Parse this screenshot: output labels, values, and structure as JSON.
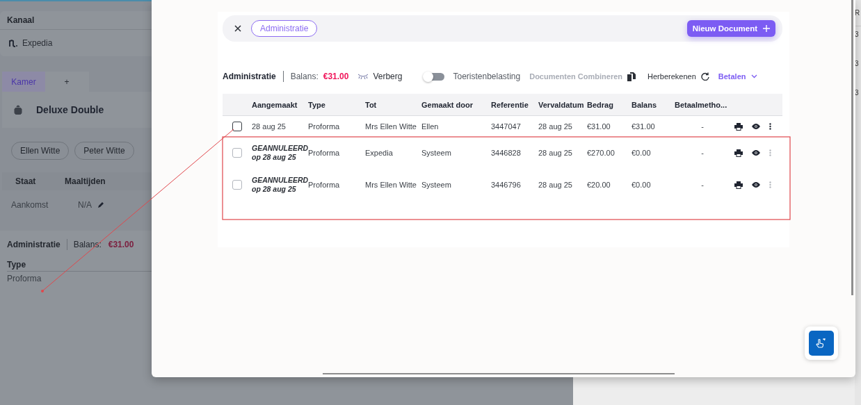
{
  "background": {
    "channel_label": "Kanaal",
    "channel": "Expedia",
    "tabs": [
      {
        "label": "Kamer",
        "selected": true
      },
      {
        "label": "+",
        "selected": false
      }
    ],
    "room": "Deluxe Double",
    "guests": [
      "Ellen Witte",
      "Peter Witte"
    ],
    "columns": [
      "Staat",
      "Maaltijden"
    ],
    "row": [
      "Aankomst",
      "N/A"
    ],
    "admin": {
      "title": "Administratie",
      "balance_label": "Balans:",
      "balance": "€31.00",
      "type_label": "Type",
      "type_value": "Proforma"
    },
    "edge_header": "R",
    "edge_cells": [
      "3",
      "3",
      "3"
    ]
  },
  "modal": {
    "filter_chip": "Administratie",
    "new_button": "Nieuw Document",
    "toolbar": {
      "title": "Administratie",
      "balance_label": "Balans:",
      "balance": "€31.00",
      "hide": "Verberg",
      "toggle": {
        "label": "Toeristenbelasting",
        "on": false
      },
      "combine": {
        "label": "Documenten Combineren",
        "disabled": true
      },
      "recalc": "Herberekenen",
      "pay": "Betalen"
    },
    "columns": [
      "Aangemaakt",
      "Type",
      "Tot",
      "Gemaakt door",
      "Referentie",
      "Vervaldatum",
      "Bedrag",
      "Balans",
      "Betaalmetho..."
    ],
    "rows": [
      {
        "kind": "active",
        "checked": false,
        "created": "28 aug 25",
        "type": "Proforma",
        "to": "Mrs Ellen Witte",
        "by": "Ellen",
        "ref": "3447047",
        "due": "28 aug 25",
        "amount": "€31.00",
        "balance": "€31.00",
        "method": "-"
      },
      {
        "kind": "cancelled",
        "checked": false,
        "status": "GEANNULEERD",
        "created": "op 28 aug 25",
        "type": "Proforma",
        "to": "Expedia",
        "by": "Systeem",
        "ref": "3446828",
        "due": "28 aug 25",
        "amount": "€270.00",
        "balance": "€0.00",
        "method": "-"
      },
      {
        "kind": "cancelled",
        "checked": false,
        "status": "GEANNULEERD",
        "created": "op 28 aug 25",
        "type": "Proforma",
        "to": "Mrs Ellen Witte",
        "by": "Systeem",
        "ref": "3446796",
        "due": "28 aug 25",
        "amount": "€20.00",
        "balance": "€0.00",
        "method": "-"
      }
    ]
  }
}
